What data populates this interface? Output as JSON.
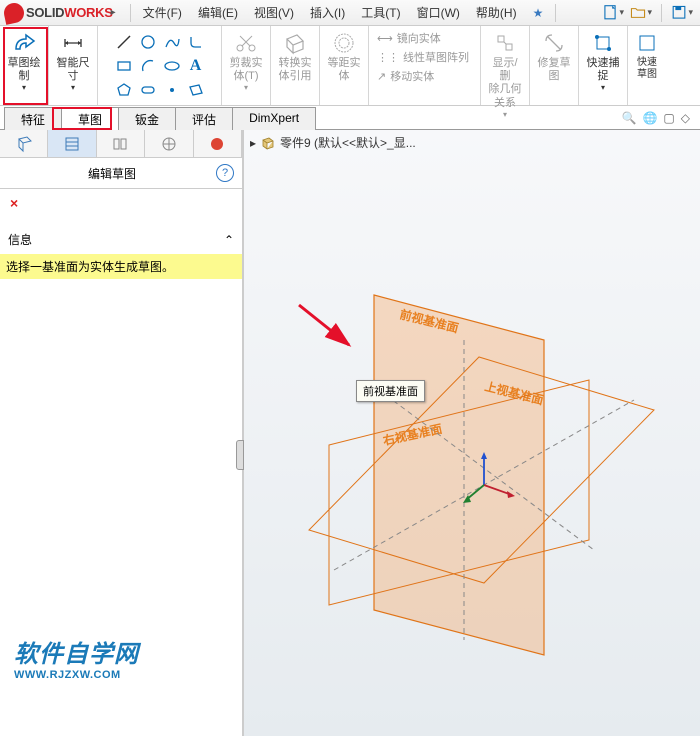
{
  "app": {
    "logo_text_prefix": "SOLID",
    "logo_text_suffix": "WORKS"
  },
  "menu": {
    "file": "文件(F)",
    "edit": "编辑(E)",
    "view": "视图(V)",
    "insert": "插入(I)",
    "tools": "工具(T)",
    "window": "窗口(W)",
    "help": "帮助(H)",
    "star": "★"
  },
  "ribbon": {
    "sketch_draw": "草图绘\n制",
    "smart_dim": "智能尺\n寸",
    "trim": "剪裁实\n体(T)",
    "convert": "转换实\n体引用",
    "offset": "等距实\n体",
    "mirror": "镜向实体",
    "linear_pattern": "线性草图阵列",
    "move": "移动实体",
    "show_hide": "显示/删\n除几何\n关系",
    "repair": "修复草\n图",
    "quick_snap": "快速捕\n捉",
    "quick_sketch": "快速\n草图"
  },
  "tabs": {
    "feature": "特征",
    "sketch": "草图",
    "sheetmetal": "钣金",
    "evaluate": "评估",
    "dimxpert": "DimXpert"
  },
  "panel": {
    "title": "编辑草图",
    "close": "×",
    "info_label": "信息",
    "info_msg": "选择一基准面为实体生成草图。"
  },
  "breadcrumb": {
    "part_label": "零件9 (默认<<默认>_显..."
  },
  "planes": {
    "front": "前视基准面",
    "top": "上视基准面",
    "right": "右视基准面"
  },
  "tooltip": {
    "text": "前视基准面"
  },
  "watermark": {
    "line1": "软件自学网",
    "line2": "WWW.RJZXW.COM"
  }
}
